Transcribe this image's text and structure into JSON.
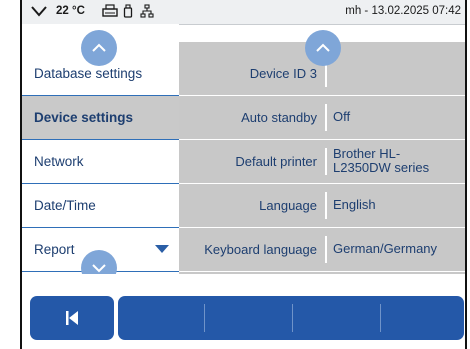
{
  "status": {
    "temperature": "22 °C",
    "user_datetime": "mh - 13.02.2025 07:42",
    "icons": [
      "chevron-down-icon",
      "printer-icon",
      "usb-stick-icon",
      "network-icon"
    ]
  },
  "menu": {
    "items": [
      {
        "label": "Database settings",
        "active": false
      },
      {
        "label": "Device settings",
        "active": true
      },
      {
        "label": "Network",
        "active": false
      },
      {
        "label": "Date/Time",
        "active": false
      },
      {
        "label": "Report",
        "active": false
      }
    ]
  },
  "settings": [
    {
      "label": "Device ID 3",
      "value": ""
    },
    {
      "label": "Auto standby",
      "value": "Off"
    },
    {
      "label": "Default printer",
      "value": "Brother HL-L2350DW series"
    },
    {
      "label": "Language",
      "value": "English"
    },
    {
      "label": "Keyboard language",
      "value": "German/Germany"
    }
  ],
  "colors": {
    "accent": "#2458a8",
    "scroll_button": "#7fa6d8",
    "table_bg": "#c8c8c8",
    "active_menu_bg": "#c9c9c9",
    "text": "#1d3e70"
  }
}
